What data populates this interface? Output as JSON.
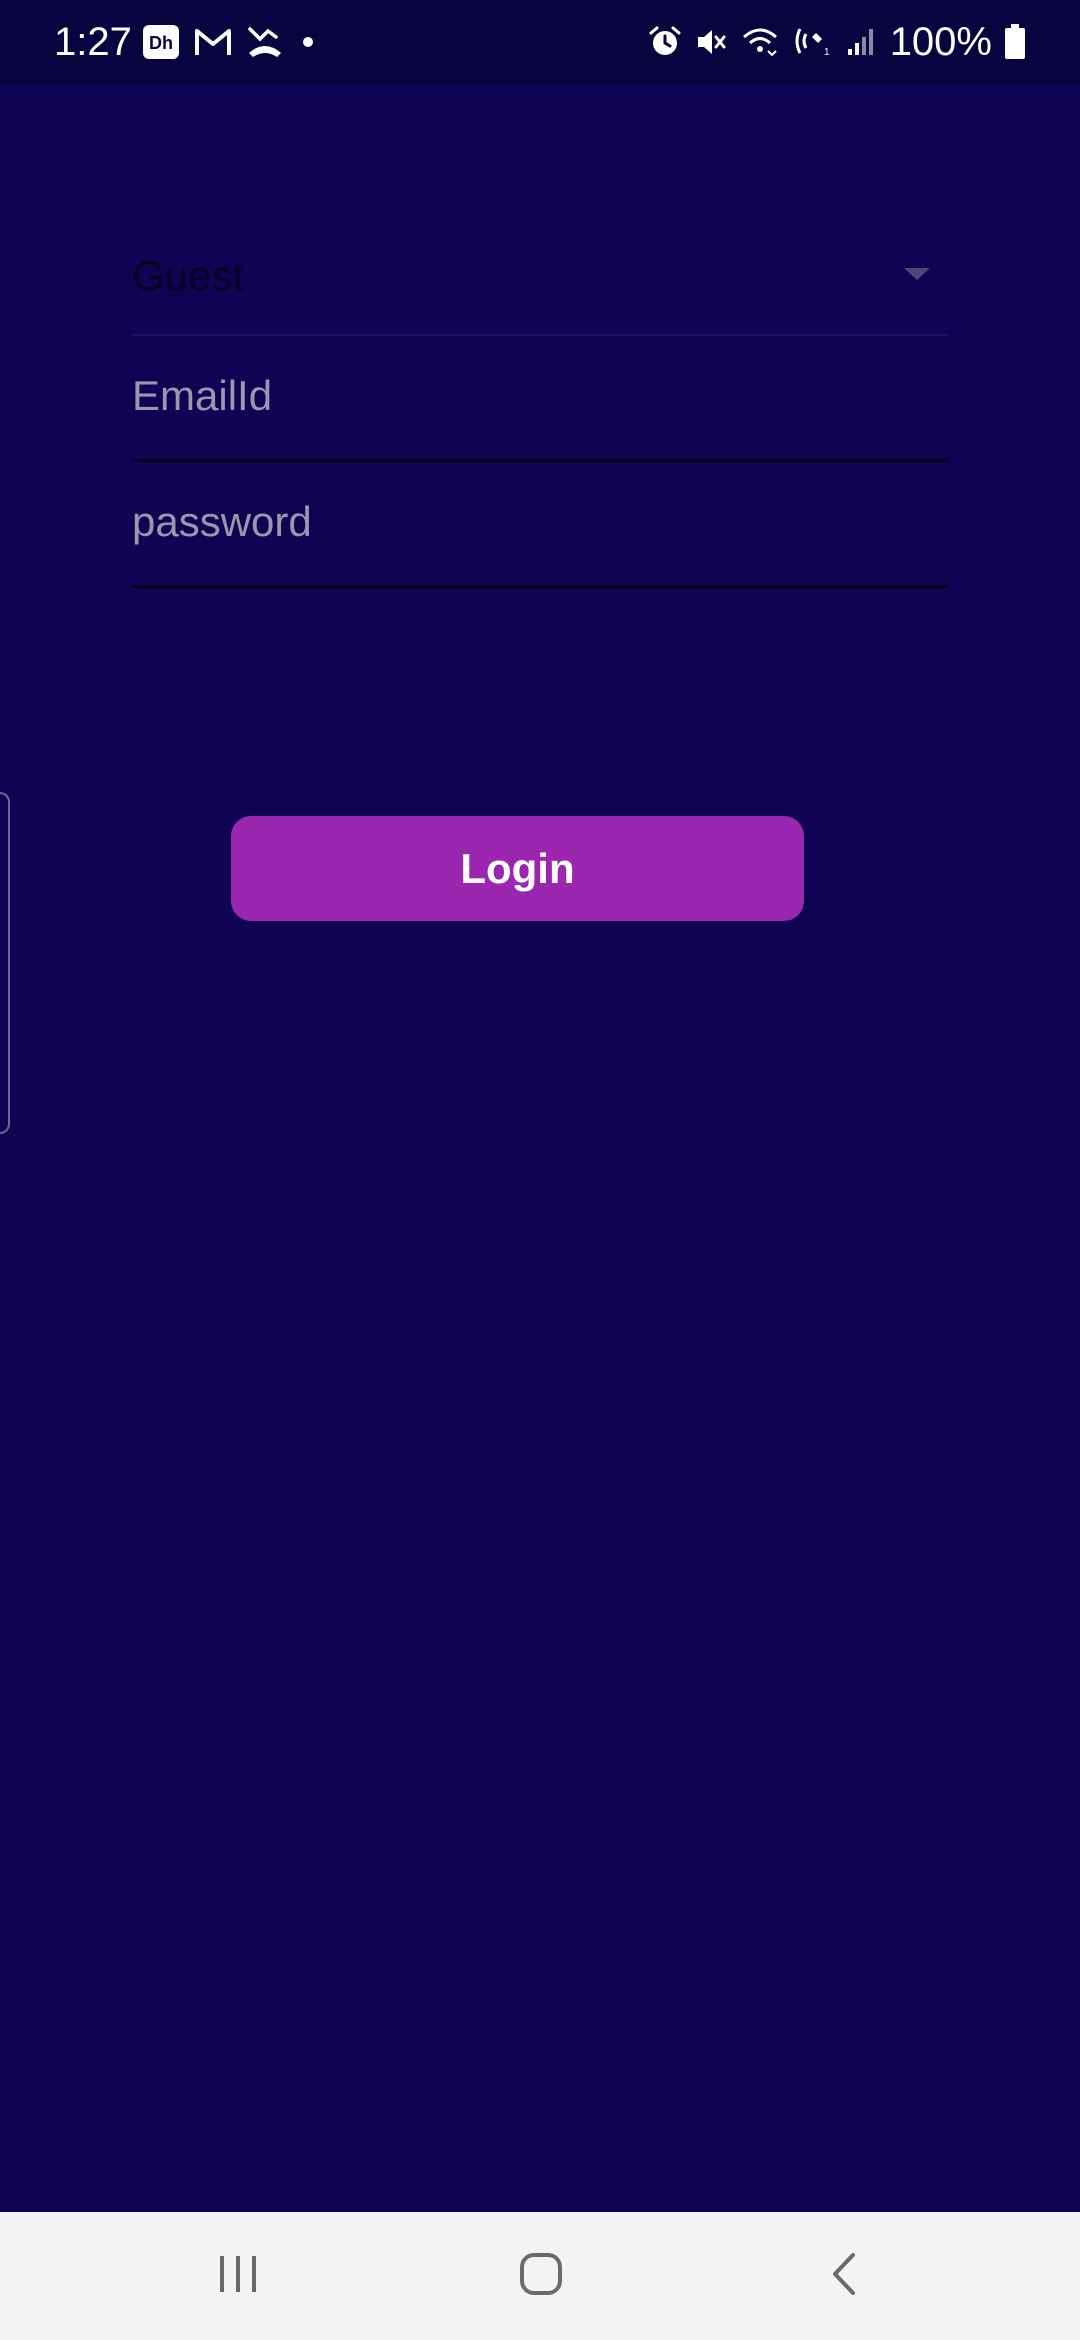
{
  "status_bar": {
    "time": "1:27",
    "battery_percent": "100%",
    "left_icons": [
      "disney-hotstar-icon",
      "gmail-icon",
      "missed-call-icon",
      "dot-icon"
    ],
    "right_icons": [
      "alarm-icon",
      "mute-icon",
      "wifi-calling-icon",
      "wifi-icon",
      "signal-icon",
      "battery-icon"
    ]
  },
  "form": {
    "role_dropdown": {
      "value": "Guest"
    },
    "email": {
      "placeholder": "EmailId",
      "value": ""
    },
    "password": {
      "placeholder": "password",
      "value": ""
    },
    "login_label": "Login"
  },
  "colors": {
    "background": "#0f0453",
    "status_bar": "#080440",
    "accent": "#9b27b0",
    "nav_bar": "#f3f3f3"
  },
  "nav_bar": {
    "buttons": [
      "recents-icon",
      "home-icon",
      "back-icon"
    ]
  }
}
